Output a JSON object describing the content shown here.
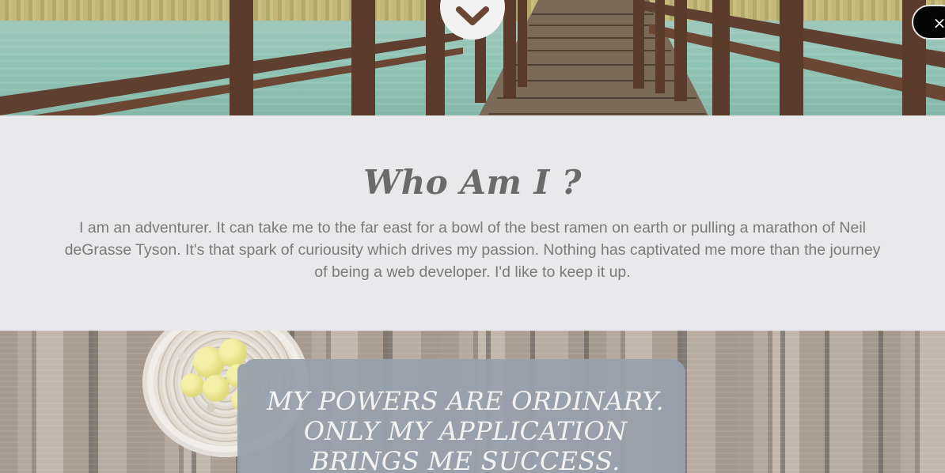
{
  "header": {
    "scroll_icon": "chevron-down-icon",
    "close_button": {
      "icon": "close-icon",
      "label": "×"
    }
  },
  "about": {
    "title": "Who Am I ?",
    "body": "I am an adventurer. It can take me to the far east for a bowl of the best ramen on earth or pulling a marathon of Neil deGrasse Tyson. It's that spark of curiousity which drives my passion. Nothing has captivated me more than the journey of being a web developer. I'd like to keep it up."
  },
  "quote": {
    "text": "My powers are ordinary. Only my application brings me success."
  },
  "colors": {
    "section_bg": "#e9e9eb",
    "heading": "#6a6a6a",
    "body_text": "#7a7a7a",
    "quote_bg": "#98a2ad",
    "quote_text": "#f7f7f7"
  }
}
